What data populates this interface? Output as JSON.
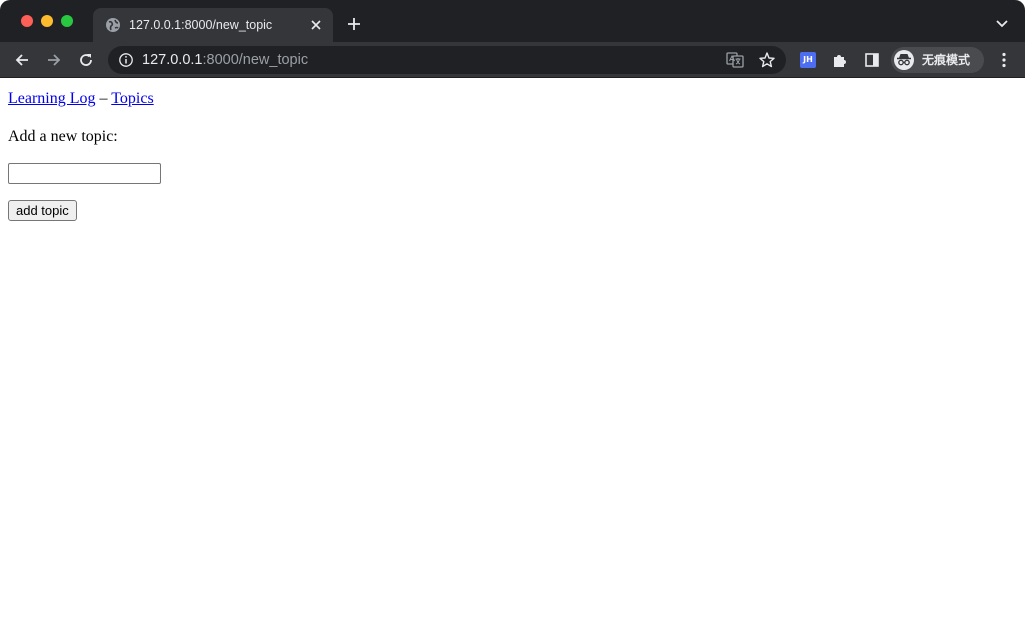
{
  "browser": {
    "tab": {
      "title": "127.0.0.1:8000/new_topic"
    },
    "address_bar": {
      "host": "127.0.0.1",
      "rest": ":8000/new_topic"
    },
    "extension_badge": "JH",
    "profile_label": "无痕模式"
  },
  "page": {
    "nav": {
      "home_link": "Learning Log",
      "separator": " – ",
      "topics_link": "Topics"
    },
    "heading": "Add a new topic:",
    "form": {
      "text_value": "",
      "submit_label": "add topic"
    }
  },
  "colors": {
    "tabstrip_bg": "#202124",
    "toolbar_bg": "#35363a",
    "link": "#0000ee"
  }
}
